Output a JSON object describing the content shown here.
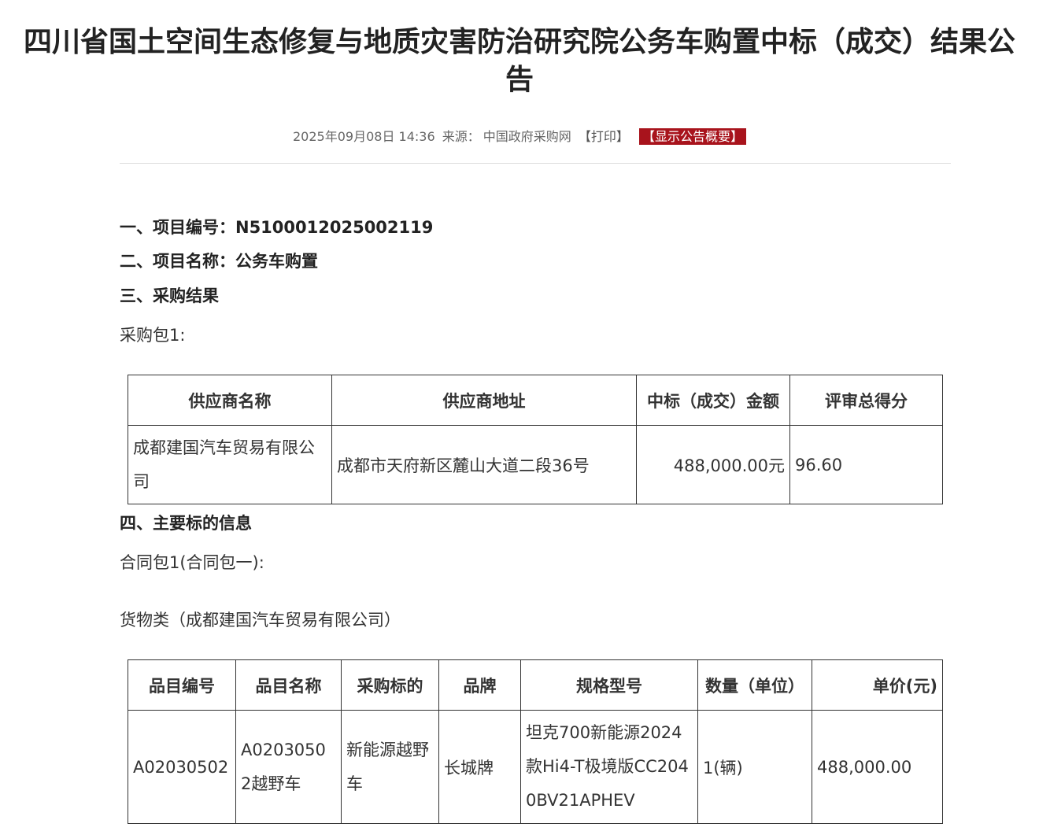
{
  "article": {
    "title": "四川省国土空间生态修复与地质灾害防治研究院公务车购置中标（成交）结果公告",
    "date": "2025年09月08日 14:36",
    "source_label": "来源：",
    "source": "中国政府采购网",
    "print_label": "【打印】",
    "summary_label": "【显示公告概要】"
  },
  "sections": {
    "project_number": "一、项目编号：N5100012025002119",
    "project_name": "二、项目名称：公务车购置",
    "procurement_result": "三、采购结果",
    "package": "采购包1:",
    "main_info": "四、主要标的信息",
    "contract_package": "合同包1(合同包一):",
    "goods_type": "货物类（成都建国汽车贸易有限公司）"
  },
  "result_table": {
    "headers": [
      "供应商名称",
      "供应商地址",
      "中标（成交）金额",
      "评审总得分"
    ],
    "row": {
      "supplier_name": "成都建国汽车贸易有限公司",
      "supplier_address": "成都市天府新区麓山大道二段36号",
      "amount": "488,000.00元",
      "score": "96.60"
    }
  },
  "goods_table": {
    "headers": [
      "品目编号",
      "品目名称",
      "采购标的",
      "品牌",
      "规格型号",
      "数量（单位）",
      "单价(元)"
    ],
    "row": {
      "item_code": "A02030502",
      "item_name": "A02030502越野车",
      "subject": "新能源越野车",
      "brand": "长城牌",
      "model": "坦克700新能源2024款Hi4-T极境版CC2040BV21APHEV",
      "quantity": "1(辆)",
      "unit_price": "488,000.00"
    }
  },
  "colors": {
    "accent": "#a8131c",
    "text": "#222222",
    "meta_text": "#666666",
    "divider": "#dddddd"
  }
}
